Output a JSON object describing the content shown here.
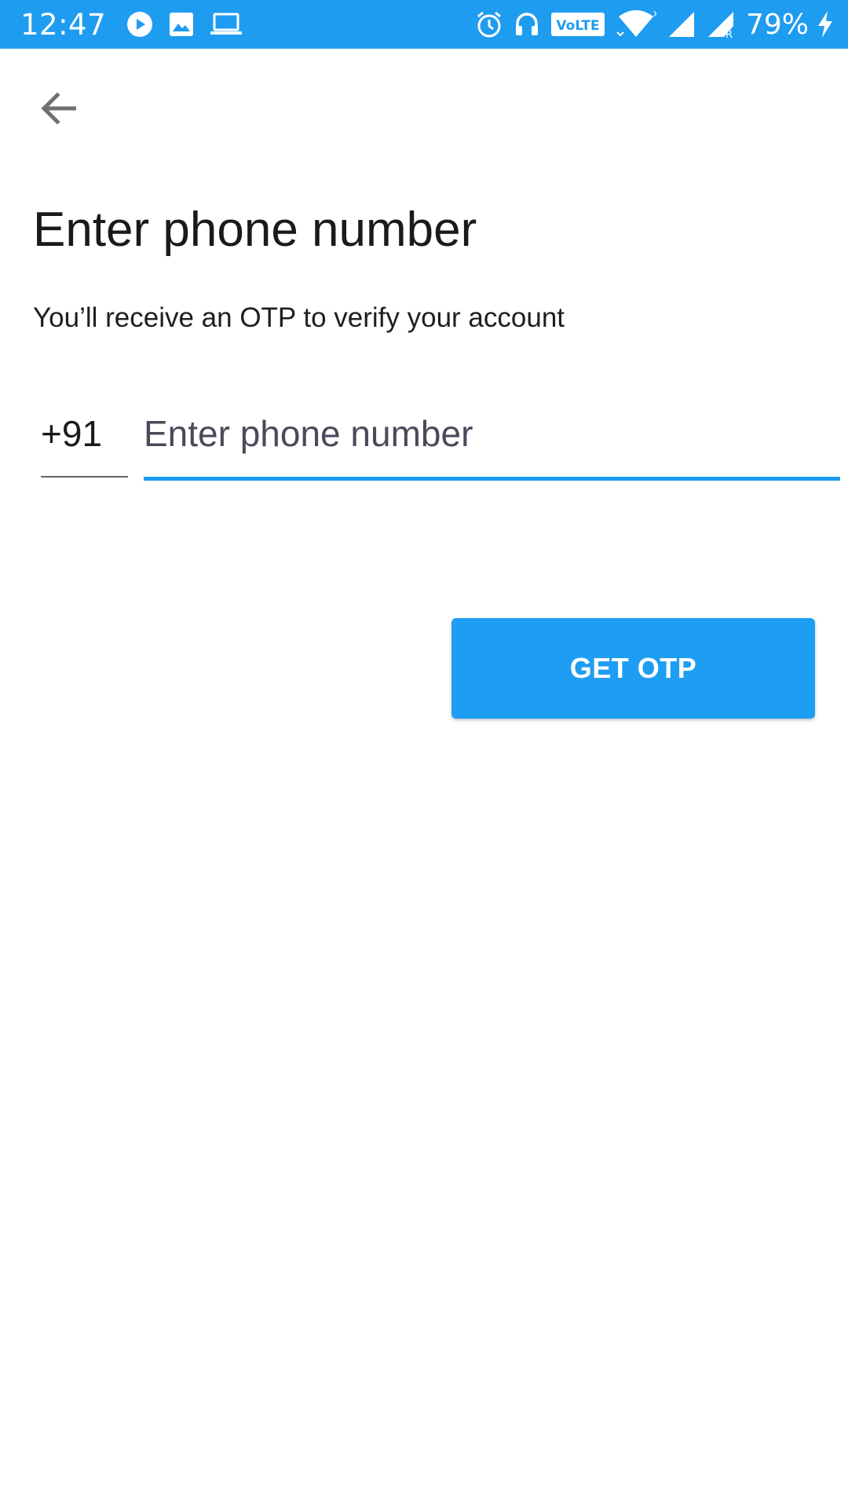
{
  "status_bar": {
    "time": "12:47",
    "battery": "79%",
    "icons_left": [
      "play-circle-icon",
      "image-icon",
      "laptop-icon"
    ],
    "icons_right": [
      "alarm-icon",
      "headphones-icon",
      "volte-icon",
      "wifi-icon",
      "signal-icon",
      "signal-roaming-icon",
      "charging-icon"
    ],
    "volte_label": "VoLTE",
    "background_color": "#1e9cf0"
  },
  "header": {
    "back_icon": "arrow-back-icon"
  },
  "main": {
    "title": "Enter phone number",
    "subtitle": "You’ll receive an OTP to verify your account",
    "country_code": "+91",
    "phone_input": {
      "value": "",
      "placeholder": "Enter phone number"
    },
    "submit_label": "GET OTP",
    "accent_color": "#1e9ef2"
  }
}
